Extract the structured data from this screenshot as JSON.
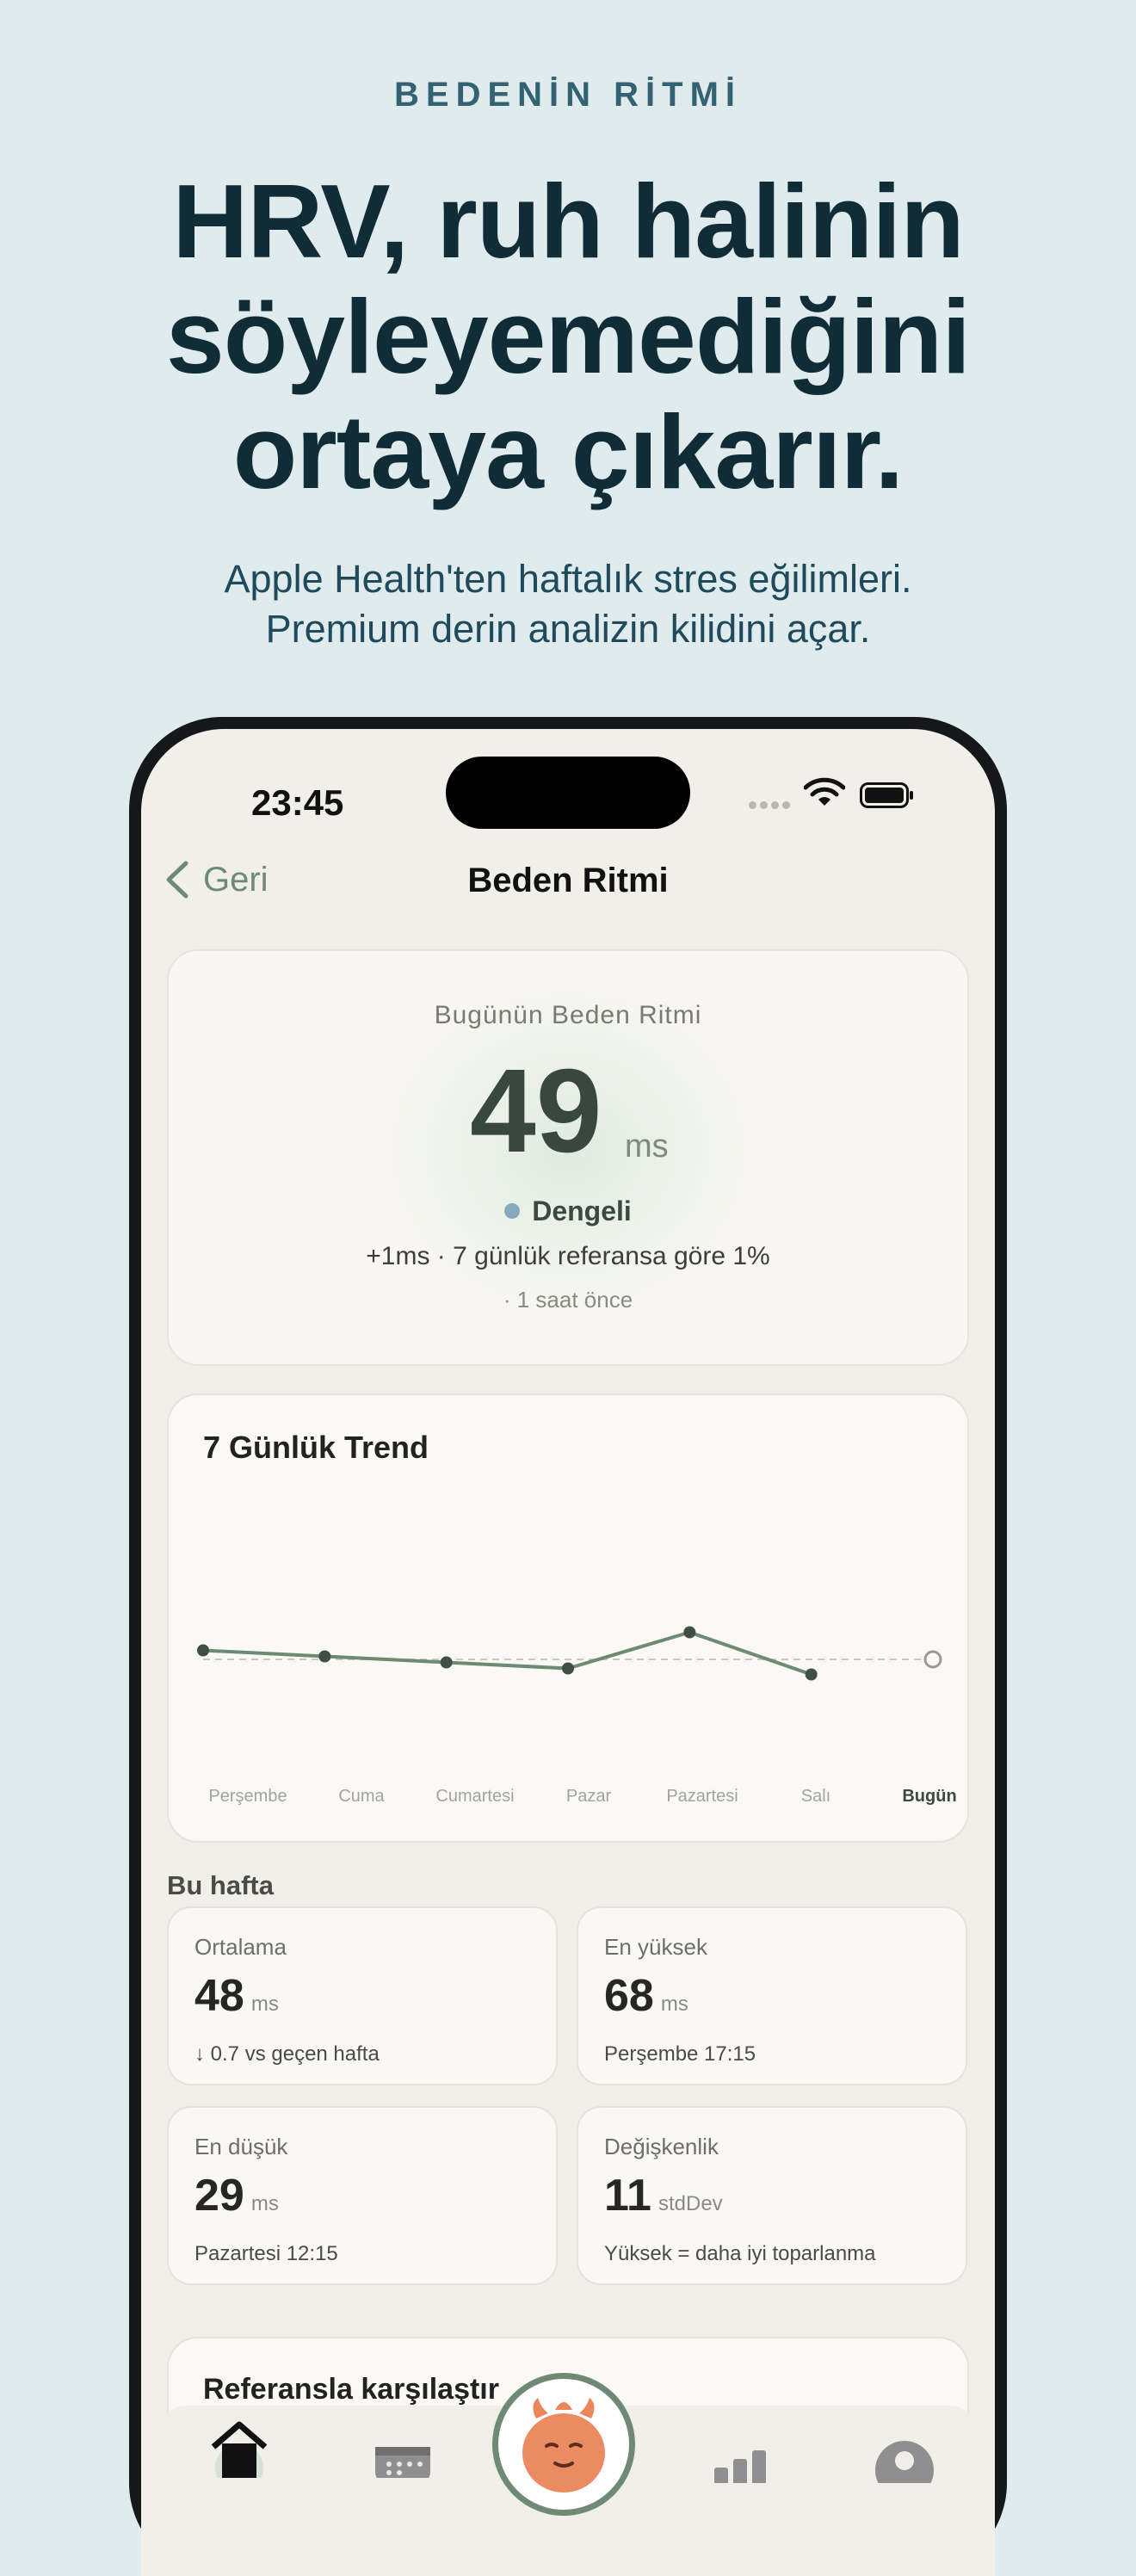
{
  "marketing": {
    "eyebrow": "BEDENİN RİTMİ",
    "headline": "HRV, ruh halinin\nsöyleyemediğini\nortaya çıkarır.",
    "subhead": "Apple Health'ten haftalık stres eğilimleri.\nPremium derin analizin kilidini açar."
  },
  "status_bar": {
    "time": "23:45"
  },
  "nav": {
    "back_label": "Geri",
    "title": "Beden Ritmi"
  },
  "today": {
    "label": "Bugünün Beden Ritmi",
    "value": "49",
    "unit": "ms",
    "state": "Dengeli",
    "state_color": "#86a9bd",
    "delta_text": "+1ms · 7 günlük referansa göre 1%",
    "updated": "· 1 saat önce"
  },
  "trend": {
    "title": "7 Günlük Trend",
    "days": [
      "Perşembe",
      "Cuma",
      "Cumartesi",
      "Pazar",
      "Pazartesi",
      "Salı",
      "Bugün"
    ]
  },
  "chart_data": {
    "type": "line",
    "title": "7 Günlük Trend",
    "categories": [
      "Perşembe",
      "Cuma",
      "Cumartesi",
      "Pazar",
      "Pazartesi",
      "Salı",
      "Bugün"
    ],
    "series": [
      {
        "values": [
          50.5,
          49.5,
          48.5,
          47.5,
          53.5,
          46.5,
          49
        ]
      }
    ],
    "baseline": 49,
    "ylim": [
      30,
      70
    ],
    "grid": false,
    "line_color": "#6e8a73",
    "baseline_color": "#c9c7c2"
  },
  "week": {
    "label": "Bu hafta",
    "stats": [
      {
        "title": "Ortalama",
        "value": "48",
        "unit": "ms",
        "note": "↓ 0.7 vs geçen hafta"
      },
      {
        "title": "En yüksek",
        "value": "68",
        "unit": "ms",
        "note": "Perşembe 17:15"
      },
      {
        "title": "En düşük",
        "value": "29",
        "unit": "ms",
        "note": "Pazartesi 12:15"
      },
      {
        "title": "Değişkenlik",
        "value": "11",
        "unit": "stdDev",
        "note": "Yüksek = daha iyi toparlanma"
      }
    ]
  },
  "compare": {
    "title": "Referansla karşılaştır"
  },
  "tab_bar": {
    "items": [
      "home-icon",
      "calendar-icon",
      "mascot-icon",
      "stats-icon",
      "profile-icon"
    ]
  }
}
